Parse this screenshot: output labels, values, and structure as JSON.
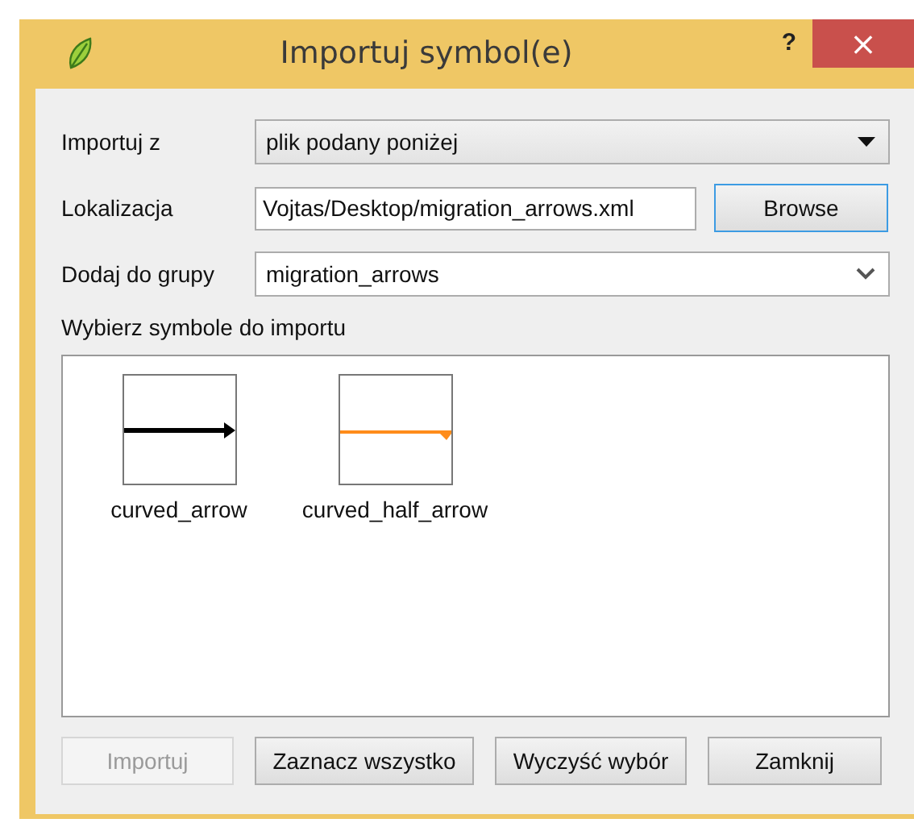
{
  "window": {
    "title": "Importuj symbol(e)",
    "help": "?",
    "close": "×"
  },
  "form": {
    "source_label": "Importuj z",
    "source_value": "plik podany poniżej",
    "location_label": "Lokalizacja",
    "location_value": "Vojtas/Desktop/migration_arrows.xml",
    "browse": {
      "label": "Browse",
      "default": true
    },
    "group_label": "Dodaj do grupy",
    "group_value": "migration_arrows",
    "list_label": "Wybierz symbole do importu"
  },
  "symbols": [
    {
      "name": "curved_arrow",
      "kind": "arrow",
      "color": "#000000"
    },
    {
      "name": "curved_half_arrow",
      "kind": "half_arrow",
      "color": "#ff8c1a"
    }
  ],
  "buttons": [
    {
      "label": "Importuj",
      "disabled": true
    },
    {
      "label": "Zaznacz wszystko",
      "disabled": false
    },
    {
      "label": "Wyczyść wybór",
      "disabled": false
    },
    {
      "label": "Zamknij",
      "disabled": false
    }
  ]
}
